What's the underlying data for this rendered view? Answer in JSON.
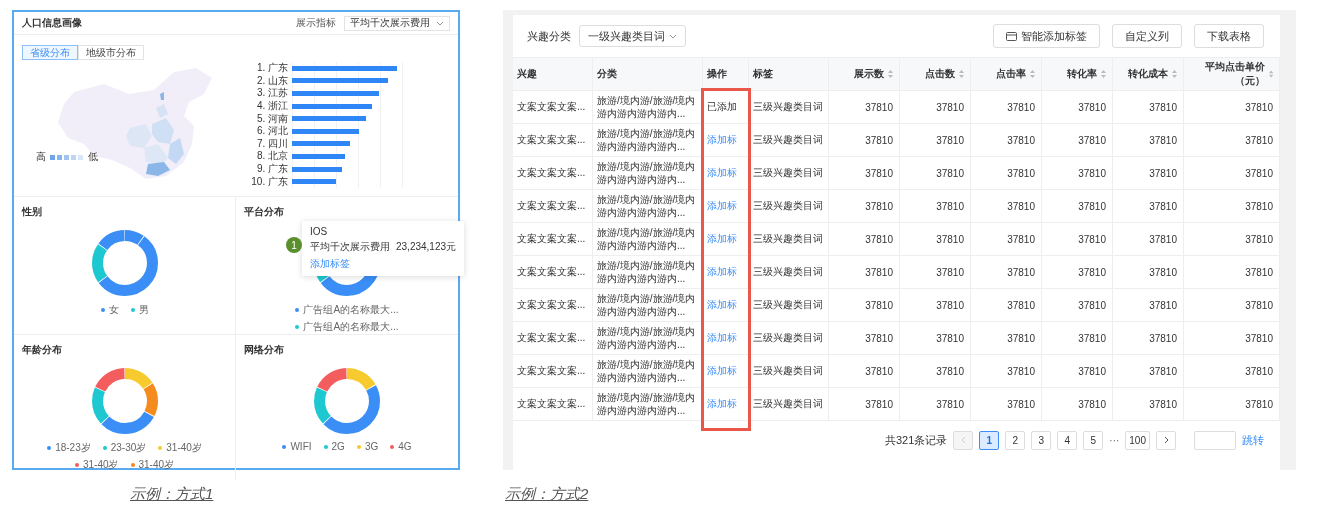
{
  "example_1": {
    "title": "人口信息画像",
    "metric_label": "展示指标",
    "metric_select": "平均千次展示费用",
    "tabs": [
      {
        "label": "省级分布",
        "selected": true
      },
      {
        "label": "地级市分布",
        "selected": false
      }
    ],
    "map_legend": {
      "high": "高",
      "low": "低"
    },
    "ranking": [
      "1. 广东",
      "2. 山东",
      "3. 江苏",
      "4. 浙江",
      "5. 河南",
      "6. 河北",
      "7. 四川",
      "8. 北京",
      "9. 广东",
      "10. 广东"
    ],
    "panels": [
      {
        "title": "性别",
        "legend": [
          {
            "label": "女",
            "color": "#3a8ef6"
          },
          {
            "label": "男",
            "color": "#1ec8d0"
          }
        ]
      },
      {
        "title": "平台分布",
        "legend": [
          {
            "label": "广告组A的名称最大...",
            "color": "#3a8ef6"
          },
          {
            "label": "广告组A的名称最大...",
            "color": "#1ec8d0"
          }
        ],
        "marker": "1",
        "tooltip": {
          "title": "IOS",
          "label": "平均千次展示费用",
          "value": "23,234,123元",
          "link": "添加标签"
        }
      },
      {
        "title": "年龄分布",
        "legend": [
          {
            "label": "18-23岁",
            "color": "#3a8ef6"
          },
          {
            "label": "23-30岁",
            "color": "#1ec8d0"
          },
          {
            "label": "31-40岁",
            "color": "#f7cb2e"
          },
          {
            "label": "31-40岁",
            "color": "#f45d5d"
          },
          {
            "label": "31-40岁",
            "color": "#f58a1f"
          }
        ]
      },
      {
        "title": "网络分布",
        "legend": [
          {
            "label": "WIFI",
            "color": "#3a8ef6"
          },
          {
            "label": "2G",
            "color": "#1ec8d0"
          },
          {
            "label": "3G",
            "color": "#f7cb2e"
          },
          {
            "label": "4G",
            "color": "#f45d5d"
          }
        ]
      }
    ]
  },
  "caption_1": "示例：方式1",
  "example_2": {
    "filter_label": "兴趣分类",
    "filter_select": "一级兴趣类目词",
    "buttons": [
      {
        "label": "智能添加标签",
        "kind": "icon"
      },
      {
        "label": "自定义列",
        "kind": "plain"
      },
      {
        "label": "下载表格",
        "kind": "plain"
      }
    ],
    "columns": [
      {
        "label": "兴趣",
        "kind": "text",
        "sortable": false
      },
      {
        "label": "分类",
        "kind": "text",
        "sortable": false
      },
      {
        "label": "操作",
        "kind": "text",
        "sortable": false
      },
      {
        "label": "标签",
        "kind": "text",
        "sortable": false
      },
      {
        "label": "展示数",
        "kind": "number",
        "sortable": true
      },
      {
        "label": "点击数",
        "kind": "number",
        "sortable": true
      },
      {
        "label": "点击率",
        "kind": "number",
        "sortable": true
      },
      {
        "label": "转化率",
        "kind": "number",
        "sortable": true
      },
      {
        "label": "转化成本",
        "kind": "number",
        "sortable": true
      },
      {
        "label": "平均点击单价（元）",
        "kind": "number",
        "sortable": true
      }
    ],
    "rows": [
      {
        "interest": "文案文案文案...",
        "category": "旅游/境内游/旅游/境内游内游内游内游内...",
        "action": {
          "label": "已添加",
          "kind": "added"
        },
        "tag": "三级兴趣类目词",
        "values": [
          "37810",
          "37810",
          "37810",
          "37810",
          "37810",
          "37810"
        ]
      },
      {
        "interest": "文案文案文案...",
        "category": "旅游/境内游/旅游/境内游内游内游内游内...",
        "action": {
          "label": "添加标",
          "kind": "link"
        },
        "tag": "三级兴趣类目词",
        "values": [
          "37810",
          "37810",
          "37810",
          "37810",
          "37810",
          "37810"
        ]
      },
      {
        "interest": "文案文案文案...",
        "category": "旅游/境内游/旅游/境内游内游内游内游内...",
        "action": {
          "label": "添加标",
          "kind": "link"
        },
        "tag": "三级兴趣类目词",
        "values": [
          "37810",
          "37810",
          "37810",
          "37810",
          "37810",
          "37810"
        ]
      },
      {
        "interest": "文案文案文案...",
        "category": "旅游/境内游/旅游/境内游内游内游内游内...",
        "action": {
          "label": "添加标",
          "kind": "link"
        },
        "tag": "三级兴趣类目词",
        "values": [
          "37810",
          "37810",
          "37810",
          "37810",
          "37810",
          "37810"
        ]
      },
      {
        "interest": "文案文案文案...",
        "category": "旅游/境内游/旅游/境内游内游内游内游内...",
        "action": {
          "label": "添加标",
          "kind": "link"
        },
        "tag": "三级兴趣类目词",
        "values": [
          "37810",
          "37810",
          "37810",
          "37810",
          "37810",
          "37810"
        ]
      },
      {
        "interest": "文案文案文案...",
        "category": "旅游/境内游/旅游/境内游内游内游内游内...",
        "action": {
          "label": "添加标",
          "kind": "link"
        },
        "tag": "三级兴趣类目词",
        "values": [
          "37810",
          "37810",
          "37810",
          "37810",
          "37810",
          "37810"
        ]
      },
      {
        "interest": "文案文案文案...",
        "category": "旅游/境内游/旅游/境内游内游内游内游内...",
        "action": {
          "label": "添加标",
          "kind": "link"
        },
        "tag": "三级兴趣类目词",
        "values": [
          "37810",
          "37810",
          "37810",
          "37810",
          "37810",
          "37810"
        ]
      },
      {
        "interest": "文案文案文案...",
        "category": "旅游/境内游/旅游/境内游内游内游内游内...",
        "action": {
          "label": "添加标",
          "kind": "link"
        },
        "tag": "三级兴趣类目词",
        "values": [
          "37810",
          "37810",
          "37810",
          "37810",
          "37810",
          "37810"
        ]
      },
      {
        "interest": "文案文案文案...",
        "category": "旅游/境内游/旅游/境内游内游内游内游内...",
        "action": {
          "label": "添加标",
          "kind": "link"
        },
        "tag": "三级兴趣类目词",
        "values": [
          "37810",
          "37810",
          "37810",
          "37810",
          "37810",
          "37810"
        ]
      },
      {
        "interest": "文案文案文案...",
        "category": "旅游/境内游/旅游/境内游内游内游内游内...",
        "action": {
          "label": "添加标",
          "kind": "link"
        },
        "tag": "三级兴趣类目词",
        "values": [
          "37810",
          "37810",
          "37810",
          "37810",
          "37810",
          "37810"
        ]
      }
    ],
    "pagination": {
      "total": "共321条记录",
      "prev_disabled": true,
      "pages": [
        {
          "label": "1",
          "kind": "page",
          "selected": true
        },
        {
          "label": "2",
          "kind": "page",
          "selected": false
        },
        {
          "label": "3",
          "kind": "page",
          "selected": false
        },
        {
          "label": "4",
          "kind": "page",
          "selected": false
        },
        {
          "label": "5",
          "kind": "page",
          "selected": false
        },
        {
          "label": "···",
          "kind": "ellipsis"
        },
        {
          "label": "100",
          "kind": "page",
          "selected": false
        }
      ],
      "jump": "跳转"
    }
  },
  "caption_2": "示例：方式2"
}
